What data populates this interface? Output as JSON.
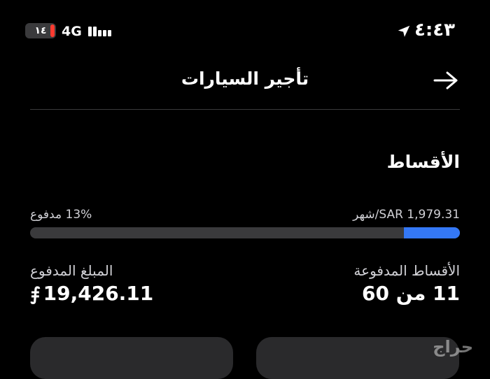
{
  "status_bar": {
    "battery_text": "١٤",
    "battery_level": 0.14,
    "battery_color": "#ff3b30",
    "network": "4G",
    "time": "٤:٤٣"
  },
  "header": {
    "title": "تأجير السيارات",
    "back_icon": "arrow-right-icon"
  },
  "installments": {
    "section_title": "الأقساط",
    "per_month": "SAR 1,979.31/شهر",
    "paid_percent_text": "13% مدفوع",
    "progress_fraction": 0.13,
    "progress_color": "#3478f6",
    "paid_installments_label": "الأقساط المدفوعة",
    "paid_installments_value": "11 من 60",
    "amount_paid_label": "المبلغ المدفوع",
    "amount_paid_value": "19,426.11",
    "currency_symbol": "⃁"
  },
  "watermark": "حراج"
}
